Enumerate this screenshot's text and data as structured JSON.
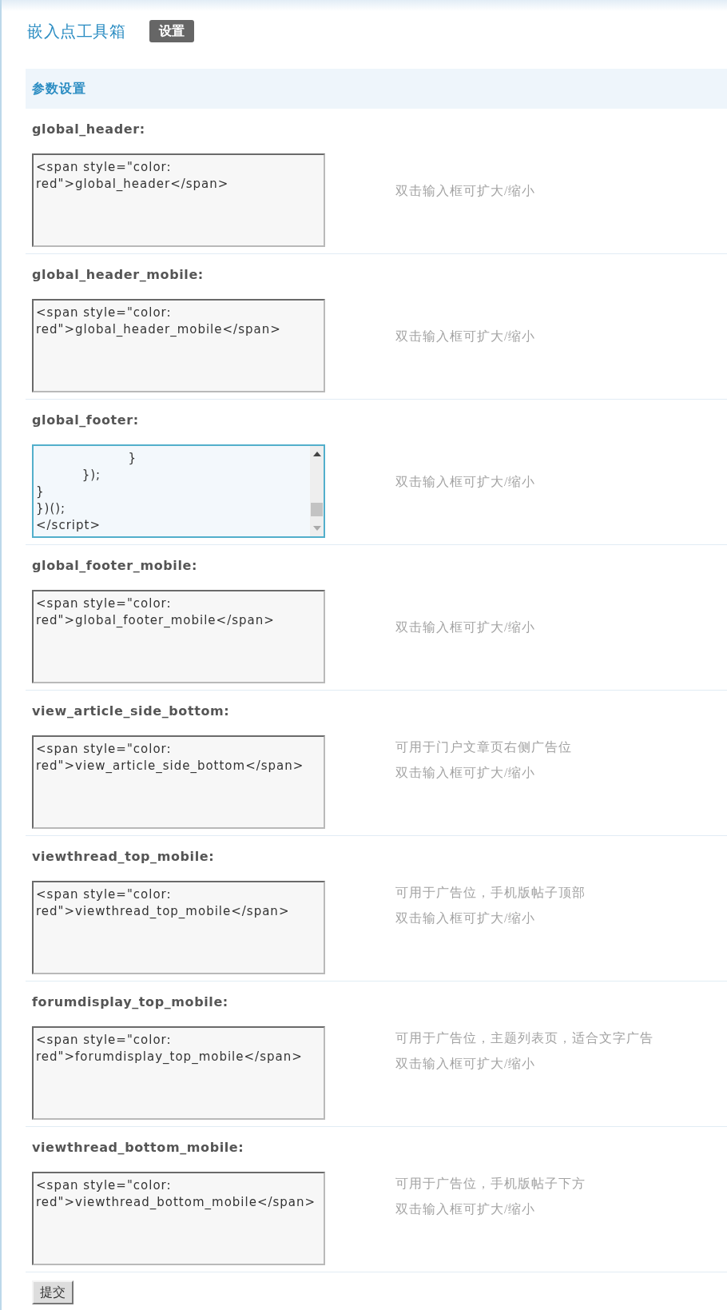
{
  "header": {
    "title": "嵌入点工具箱",
    "tabs": [
      {
        "label": "设置",
        "selected": true
      }
    ]
  },
  "section": {
    "title": "参数设置"
  },
  "fields": [
    {
      "label": "global_header:",
      "value": "<span style=\"color: red\">global_header</span>",
      "focused": false,
      "scrollbar": false,
      "hints": [
        "双击输入框可扩大/缩小"
      ]
    },
    {
      "label": "global_header_mobile:",
      "value": "<span style=\"color: red\">global_header_mobile</span>",
      "focused": false,
      "scrollbar": false,
      "hints": [
        "双击输入框可扩大/缩小"
      ]
    },
    {
      "label": "global_footer:",
      "value": "                    }\n          });\n}\n})();\n</script>",
      "focused": true,
      "scrollbar": true,
      "hints": [
        "双击输入框可扩大/缩小"
      ]
    },
    {
      "label": "global_footer_mobile:",
      "value": "<span style=\"color: red\">global_footer_mobile</span>",
      "focused": false,
      "scrollbar": false,
      "hints": [
        "双击输入框可扩大/缩小"
      ]
    },
    {
      "label": "view_article_side_bottom:",
      "value": "<span style=\"color: red\">view_article_side_bottom</span>",
      "focused": false,
      "scrollbar": false,
      "hints": [
        "可用于门户文章页右侧广告位",
        "双击输入框可扩大/缩小"
      ]
    },
    {
      "label": "viewthread_top_mobile:",
      "value": "<span style=\"color: red\">viewthread_top_mobile</span>",
      "focused": false,
      "scrollbar": false,
      "hints": [
        "可用于广告位，手机版帖子顶部",
        "双击输入框可扩大/缩小"
      ]
    },
    {
      "label": "forumdisplay_top_mobile:",
      "value": "<span style=\"color: red\">forumdisplay_top_mobile</span>",
      "focused": false,
      "scrollbar": false,
      "hints": [
        "可用于广告位，主题列表页，适合文字广告",
        "双击输入框可扩大/缩小"
      ]
    },
    {
      "label": "viewthread_bottom_mobile:",
      "value": "<span style=\"color: red\">viewthread_bottom_mobile</span>",
      "focused": false,
      "scrollbar": false,
      "hints": [
        "可用于广告位，手机版帖子下方",
        "双击输入框可扩大/缩小"
      ]
    }
  ],
  "submit": {
    "label": "提交"
  }
}
